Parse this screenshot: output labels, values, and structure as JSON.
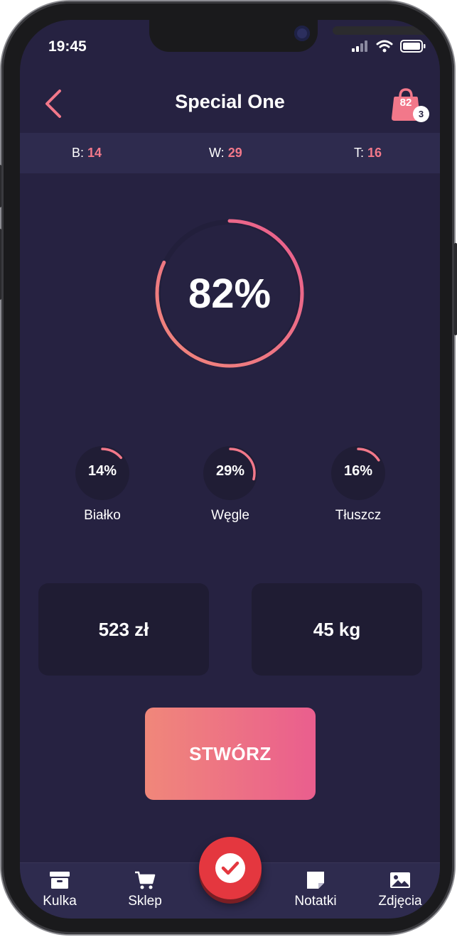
{
  "status_bar": {
    "time": "19:45"
  },
  "header": {
    "title": "Special One",
    "cart_count": "82",
    "cart_badge": "3"
  },
  "macros_bar": {
    "protein_label": "B:",
    "protein_value": "14",
    "carbs_label": "W:",
    "carbs_value": "29",
    "fat_label": "T:",
    "fat_value": "16"
  },
  "main_progress": {
    "label": "82%",
    "value": 0.82
  },
  "macro_rings": [
    {
      "percent_label": "14%",
      "name": "Białko",
      "value": 0.14
    },
    {
      "percent_label": "29%",
      "name": "Węgle",
      "value": 0.29
    },
    {
      "percent_label": "16%",
      "name": "Tłuszcz",
      "value": 0.16
    }
  ],
  "stats": {
    "price": "523 zł",
    "weight": "45 kg"
  },
  "create_button": {
    "label": "STWÓRZ"
  },
  "bottom_nav": {
    "items": [
      {
        "label": "Kulka",
        "icon": "archive-box-icon"
      },
      {
        "label": "Sklep",
        "icon": "shopping-cart-icon"
      },
      {
        "label": "Notatki",
        "icon": "note-icon"
      },
      {
        "label": "Zdjęcia",
        "icon": "image-icon"
      }
    ],
    "fab_icon": "checkmark-icon"
  },
  "colors": {
    "background": "#262241",
    "bar": "#2e2b4e",
    "card": "#1f1c33",
    "accent": "#f2788a",
    "gradient_start": "#f0877a",
    "gradient_end": "#ea5e8e",
    "fab": "#e4373f"
  }
}
